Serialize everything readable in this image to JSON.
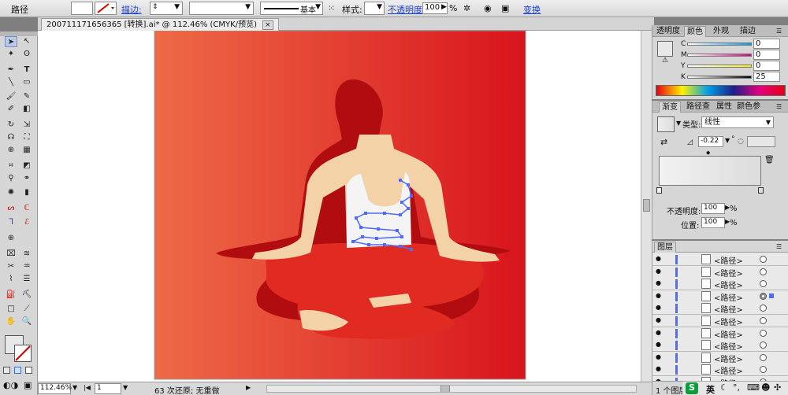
{
  "control_bar": {
    "object_type": "路径",
    "stroke_link": "描边:",
    "stroke_profile": "基本",
    "style_label": "样式:",
    "opacity_link": "不透明度:",
    "opacity_value": "100",
    "opacity_unit": "%",
    "transform_link": "变换"
  },
  "document": {
    "tab_title": "20071117165636​5 [转换].ai* @ 112.46% (CMYK/预览)",
    "close": "×"
  },
  "status_bar": {
    "zoom": "112.46%",
    "page": "1",
    "message": "63 次还原; 无重做"
  },
  "color_panel": {
    "tabs": [
      "透明度",
      "颜色",
      "外观",
      "描边"
    ],
    "active_tab": "颜色",
    "channels": [
      {
        "label": "C",
        "value": "0"
      },
      {
        "label": "M",
        "value": "0"
      },
      {
        "label": "Y",
        "value": "0"
      },
      {
        "label": "K",
        "value": "25"
      }
    ]
  },
  "gradient_panel": {
    "tabs": [
      "渐变",
      "路径查",
      "属性",
      "颜色参"
    ],
    "active_tab": "渐变",
    "type_label": "类型:",
    "type_value": "线性",
    "angle_value": "-0.22",
    "angle_unit": "°",
    "opacity_label": "不透明度:",
    "opacity_value": "100",
    "position_label": "位置:",
    "position_value": "100",
    "percent": "%"
  },
  "layers_panel": {
    "title": "图层",
    "footer": "1 个图层",
    "rows": [
      "<路径>",
      "<路径>",
      "<路径>",
      "<路径>",
      "<路径>",
      "<路径>",
      "<路径>",
      "<路径>",
      "<路径>",
      "<路径>",
      "<路径>"
    ],
    "selected_row_index": 3,
    "accent_color": "#4d6cff"
  },
  "taskbar": {
    "ime_label": "英"
  },
  "colors": {
    "canvas_gradient_left": "#ee6a47",
    "canvas_gradient_right": "#d8141c",
    "shadow": "#b10d10",
    "pants": "#e02a22",
    "skin": "#f3d2a8",
    "tank_top": "#f4f4f4",
    "selection": "#4d6cff"
  },
  "icons": [
    "selection-arrow-icon",
    "pen-icon",
    "type-icon",
    "brush-icon",
    "eyedropper-icon",
    "zoom-icon",
    "hand-icon",
    "eye-icon"
  ]
}
